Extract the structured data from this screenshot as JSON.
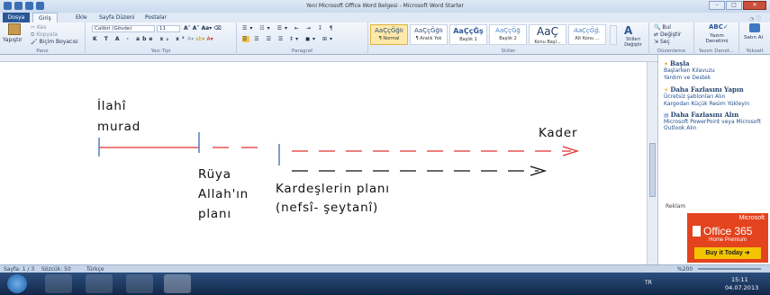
{
  "window": {
    "title": "Yeni Microsoft Office Word Belgesi - Microsoft Word Starter"
  },
  "tabs": [
    "Dosya",
    "Giriş",
    "Ekle",
    "Sayfa Düzeni",
    "Postalar"
  ],
  "clipboard": {
    "paste": "Yapıştır",
    "cut": "Kes",
    "copy": "Kopyala",
    "format_painter": "Biçim Boyacısı",
    "label": "Pano"
  },
  "font": {
    "name": "Calibri (Gövde)",
    "size": "11",
    "label": "Yazı Tipi"
  },
  "paragraph": {
    "label": "Paragraf"
  },
  "styles": {
    "label": "Stiller",
    "change": "Stilleri Değiştir",
    "items": [
      {
        "sample": "AaÇçĞğIı",
        "name": "¶ Normal"
      },
      {
        "sample": "AaÇçĞğIı",
        "name": "¶ Aralık Yok"
      },
      {
        "sample": "AaÇçĞş",
        "name": "Başlık 1"
      },
      {
        "sample": "AaÇçĞğ",
        "name": "Başlık 2"
      },
      {
        "sample": "AaÇ",
        "name": "Konu Başl..."
      },
      {
        "sample": "AaÇçĞğ.",
        "name": "Alt Konu ..."
      }
    ]
  },
  "editing": {
    "find": "Bul",
    "replace": "Değiştir",
    "select": "Seç",
    "label": "Düzenleme"
  },
  "proofing": {
    "spelling": "Yazım Denetimi",
    "label": "Yazım Denet..."
  },
  "sharing": {
    "label": "Satın Al",
    "label2": "Yükselt"
  },
  "doc": {
    "t1a": "İlahî",
    "t1b": "murad",
    "t2a": "Rüya",
    "t2b": "Allah'ın",
    "t2c": "planı",
    "t3a": "Kardeşlerin planı",
    "t3b": "(nefsî- şeytanî)",
    "t4": "Kader"
  },
  "pane": {
    "h1": "Başla",
    "l1": "Başlarken Kılavuzu",
    "l2": "Yardım ve Destek",
    "h2": "Daha Fazlasını Yapın",
    "l3": "Ücretsiz şablonları Alın",
    "l4": "Kargodan Küçük Resim Yükleyin",
    "h3": "Daha Fazlasını Alın",
    "l5": "Microsoft PowerPoint veya Microsoft Outlook Alın",
    "ad_label": "Reklam",
    "ad_brand": "Microsoft",
    "ad_product": "Office 365",
    "ad_edition": "Home Premium",
    "ad_button": "Buy it Today"
  },
  "status": {
    "page": "Sayfa: 1 / 3",
    "words": "Sözcük: 50",
    "lang": "Türkçe",
    "zoom": "%200"
  },
  "taskbar": {
    "lang": "TR",
    "time": "15:11",
    "date": "04.07.2013"
  }
}
